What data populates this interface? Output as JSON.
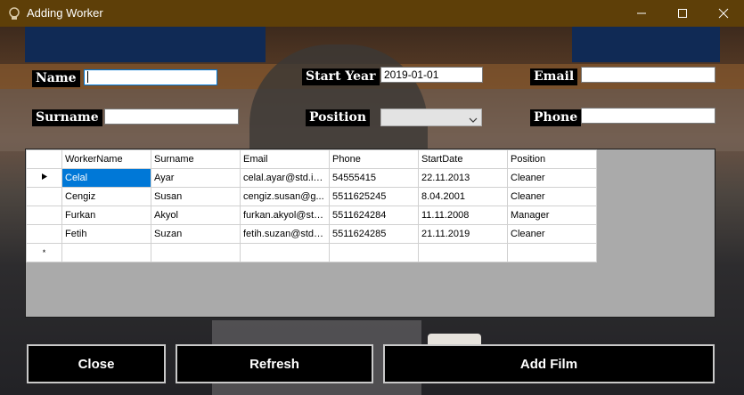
{
  "window": {
    "title": "Adding Worker"
  },
  "form": {
    "name_label": "Name",
    "surname_label": "Surname",
    "start_year_label": "Start Year",
    "start_year_value": "2019-01-01",
    "position_label": "Position",
    "email_label": "Email",
    "phone_label": "Phone"
  },
  "grid": {
    "columns": [
      "WorkerName",
      "Surname",
      "Email",
      "Phone",
      "StartDate",
      "Position"
    ],
    "rows": [
      [
        "Celal",
        "Ayar",
        "celal.ayar@std.iz...",
        "54555415",
        "22.11.2013",
        "Cleaner"
      ],
      [
        "Cengiz",
        "Susan",
        "cengiz.susan@g...",
        "5511625245",
        "8.04.2001",
        "Cleaner"
      ],
      [
        "Furkan",
        "Akyol",
        "furkan.akyol@std...",
        "5511624284",
        "11.11.2008",
        "Manager"
      ],
      [
        "Fetih",
        "Suzan",
        "fetih.suzan@std.i...",
        "5511624285",
        "21.11.2019",
        "Cleaner"
      ]
    ],
    "new_row_marker": "*"
  },
  "buttons": {
    "close": "Close",
    "refresh": "Refresh",
    "add": "Add Film"
  }
}
